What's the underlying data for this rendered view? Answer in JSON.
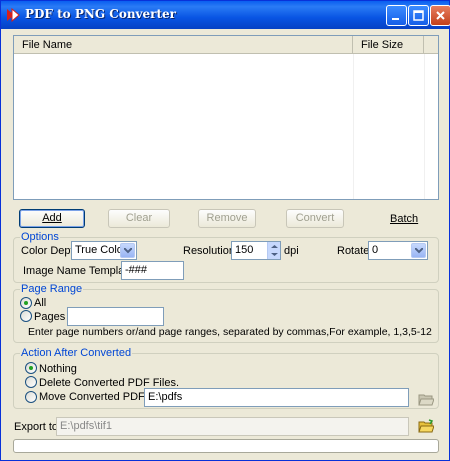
{
  "window": {
    "title": "PDF to PNG Converter"
  },
  "filelist": {
    "columns": [
      "File Name",
      "File Size"
    ]
  },
  "actions": {
    "add": "Add",
    "clear": "Clear",
    "remove": "Remove",
    "convert": "Convert",
    "batch": "Batch"
  },
  "options": {
    "title": "Options",
    "color_depth_label": "Color Depth",
    "color_depth_value": "True Colors",
    "resolution_label": "Resolution",
    "resolution_value": "150",
    "resolution_unit": "dpi",
    "rotate_label": "Rotate",
    "rotate_value": "0",
    "template_label": "Image Name Template",
    "template_value": "-###"
  },
  "page_range": {
    "title": "Page Range",
    "all_label": "All",
    "pages_label": "Pages",
    "pages_value": "",
    "hint": "Enter page numbers or/and page ranges, separated by commas,For example, 1,3,5-12"
  },
  "after": {
    "title": "Action After Converted",
    "nothing_label": "Nothing",
    "delete_label": "Delete Converted PDF Files.",
    "move_label": "Move Converted PDF to",
    "move_value": "E:\\pdfs"
  },
  "export": {
    "label": "Export to",
    "value": "E:\\pdfs\\tif1"
  },
  "colors": {
    "accent": "#0046d5",
    "titlebar": "#0854e3"
  }
}
